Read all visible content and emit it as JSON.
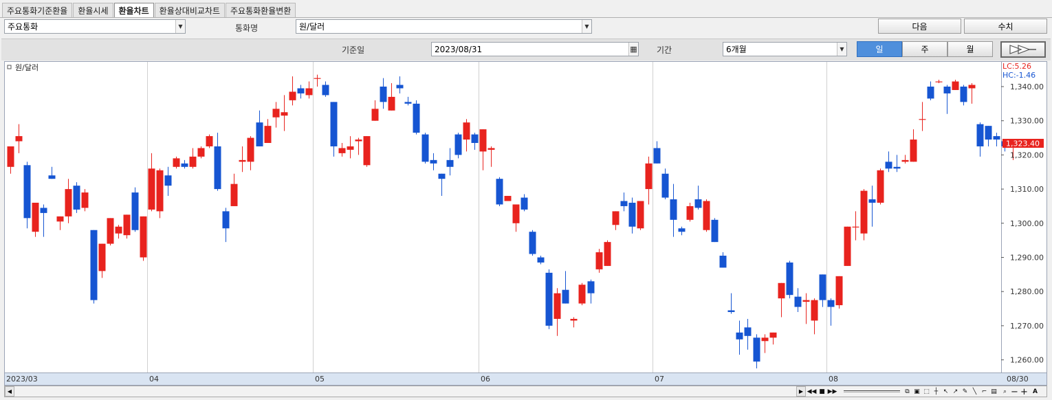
{
  "tabs": [
    {
      "label": "주요통화기준환율",
      "active": false
    },
    {
      "label": "환율시세",
      "active": false
    },
    {
      "label": "환율차트",
      "active": true
    },
    {
      "label": "환율상대비교차트",
      "active": false
    },
    {
      "label": "주요통화환율변환",
      "active": false
    }
  ],
  "row1": {
    "currency_group": "주요통화",
    "currency_name_label": "통화명",
    "currency_name": "원/달러",
    "next_button": "다음",
    "value_button": "수치"
  },
  "row2": {
    "base_date_label": "기준일",
    "base_date": "2023/08/31",
    "period_label": "기간",
    "period": "6개월",
    "period_units": [
      {
        "label": "일",
        "active": true
      },
      {
        "label": "주",
        "active": false
      },
      {
        "label": "월",
        "active": false
      }
    ],
    "forward_icon": "double-chevron-right-icon"
  },
  "colors": {
    "up": "#e8231e",
    "down": "#1655d2",
    "current_price_bg": "#e8231e"
  },
  "chart_data": {
    "type": "candlestick",
    "title": "원/달러",
    "lc_label": "LC:5.26",
    "hc_label": "HC:-1.46",
    "current_price_label": "1,323.40",
    "current_price": 1323.4,
    "ylim": [
      1255,
      1345
    ],
    "y_ticks": [
      {
        "value": 1260,
        "label": "1,260.00"
      },
      {
        "value": 1270,
        "label": "1,270.00"
      },
      {
        "value": 1280,
        "label": "1,280.00"
      },
      {
        "value": 1290,
        "label": "1,290.00"
      },
      {
        "value": 1300,
        "label": "1,300.00"
      },
      {
        "value": 1310,
        "label": "1,310.00"
      },
      {
        "value": 1320,
        "label": "1,320.00"
      },
      {
        "value": 1330,
        "label": "1,330.00"
      },
      {
        "value": 1340,
        "label": "1,340.00"
      }
    ],
    "x_labels": [
      {
        "index": 0,
        "label": "2023/03",
        "gridline": false
      },
      {
        "index": 17,
        "label": "04",
        "gridline": true
      },
      {
        "index": 37,
        "label": "05",
        "gridline": true
      },
      {
        "index": 57,
        "label": "06",
        "gridline": true
      },
      {
        "index": 78,
        "label": "07",
        "gridline": true
      },
      {
        "index": 99,
        "label": "08",
        "gridline": true
      },
      {
        "index": 120,
        "label": "08/30",
        "gridline": false
      }
    ],
    "candles": [
      [
        1316.5,
        1322.5,
        1314.5,
        1322.5
      ],
      [
        1324.0,
        1329.0,
        1320.5,
        1325.5
      ],
      [
        1317.0,
        1318.0,
        1298.5,
        1301.5
      ],
      [
        1297.5,
        1305.0,
        1296.0,
        1306.0
      ],
      [
        1304.5,
        1305.5,
        1296.0,
        1303.0
      ],
      [
        1314.0,
        1316.5,
        1313.0,
        1313.0
      ],
      [
        1300.5,
        1302.0,
        1298.0,
        1302.0
      ],
      [
        1302.0,
        1313.0,
        1300.0,
        1310.0
      ],
      [
        1311.0,
        1312.0,
        1303.0,
        1304.0
      ],
      [
        1304.5,
        1310.0,
        1303.5,
        1309.0
      ],
      [
        1298.0,
        1298.0,
        1276.5,
        1277.5
      ],
      [
        1286.0,
        1294.0,
        1284.0,
        1294.0
      ],
      [
        1294.0,
        1301.5,
        1293.5,
        1301.5
      ],
      [
        1297.0,
        1299.5,
        1295.5,
        1299.0
      ],
      [
        1296.5,
        1302.5,
        1295.5,
        1302.5
      ],
      [
        1309.0,
        1310.5,
        1297.5,
        1298.0
      ],
      [
        1290.0,
        1302.0,
        1289.0,
        1302.0
      ],
      [
        1304.0,
        1320.5,
        1303.5,
        1316.0
      ],
      [
        1303.5,
        1316.0,
        1301.5,
        1315.5
      ],
      [
        1314.0,
        1316.5,
        1308.0,
        1311.0
      ],
      [
        1316.5,
        1319.5,
        1316.0,
        1319.0
      ],
      [
        1317.5,
        1318.5,
        1316.0,
        1316.5
      ],
      [
        1316.5,
        1322.0,
        1316.0,
        1319.5
      ],
      [
        1319.5,
        1322.5,
        1319.0,
        1322.0
      ],
      [
        1322.5,
        1326.0,
        1322.0,
        1325.5
      ],
      [
        1322.5,
        1326.5,
        1309.5,
        1310.0
      ],
      [
        1303.5,
        1304.5,
        1294.5,
        1298.5
      ],
      [
        1305.0,
        1314.5,
        1305.0,
        1311.5
      ],
      [
        1318.0,
        1322.5,
        1315.0,
        1318.5
      ],
      [
        1318.0,
        1325.5,
        1315.5,
        1325.0
      ],
      [
        1329.5,
        1333.0,
        1322.5,
        1322.5
      ],
      [
        1323.5,
        1330.5,
        1323.5,
        1328.5
      ],
      [
        1331.0,
        1335.5,
        1328.0,
        1333.5
      ],
      [
        1331.5,
        1337.5,
        1327.0,
        1332.5
      ],
      [
        1336.0,
        1343.0,
        1334.5,
        1338.5
      ],
      [
        1339.5,
        1340.5,
        1336.5,
        1338.0
      ],
      [
        1337.5,
        1341.5,
        1336.5,
        1339.5
      ],
      [
        1342.5,
        1343.5,
        1340.0,
        1342.5
      ],
      [
        1340.5,
        1341.5,
        1337.0,
        1337.5
      ],
      [
        1335.5,
        1335.5,
        1319.5,
        1322.5
      ],
      [
        1320.5,
        1323.5,
        1319.5,
        1322.0
      ],
      [
        1321.5,
        1325.5,
        1319.0,
        1322.5
      ],
      [
        1324.0,
        1325.0,
        1320.0,
        1324.5
      ],
      [
        1317.0,
        1325.5,
        1316.5,
        1325.5
      ],
      [
        1330.0,
        1336.0,
        1330.0,
        1333.5
      ],
      [
        1340.0,
        1342.5,
        1333.5,
        1335.5
      ],
      [
        1333.0,
        1341.0,
        1333.0,
        1337.0
      ],
      [
        1340.5,
        1343.0,
        1338.0,
        1339.5
      ],
      [
        1335.5,
        1337.0,
        1334.5,
        1335.0
      ],
      [
        1335.0,
        1336.0,
        1326.0,
        1326.5
      ],
      [
        1326.0,
        1326.5,
        1317.5,
        1318.0
      ],
      [
        1318.5,
        1320.5,
        1315.5,
        1317.5
      ],
      [
        1314.5,
        1314.5,
        1308.0,
        1313.0
      ],
      [
        1318.5,
        1322.0,
        1314.0,
        1316.5
      ],
      [
        1326.0,
        1326.5,
        1319.0,
        1320.0
      ],
      [
        1324.5,
        1330.5,
        1321.0,
        1329.5
      ],
      [
        1326.0,
        1326.5,
        1321.5,
        1323.5
      ],
      [
        1321.0,
        1327.5,
        1315.5,
        1327.5
      ],
      [
        1321.5,
        1322.5,
        1316.5,
        1322.0
      ],
      [
        1313.0,
        1313.5,
        1305.0,
        1305.5
      ],
      [
        1306.5,
        1308.0,
        1306.5,
        1308.0
      ],
      [
        1300.0,
        1305.5,
        1297.5,
        1305.5
      ],
      [
        1307.5,
        1308.5,
        1303.5,
        1304.0
      ],
      [
        1297.5,
        1298.0,
        1290.5,
        1291.0
      ],
      [
        1290.0,
        1290.5,
        1288.0,
        1288.5
      ],
      [
        1285.5,
        1286.5,
        1269.0,
        1270.0
      ],
      [
        1272.0,
        1281.0,
        1267.0,
        1279.5
      ],
      [
        1280.5,
        1286.0,
        1276.5,
        1276.5
      ],
      [
        1271.5,
        1272.5,
        1269.5,
        1272.0
      ],
      [
        1276.5,
        1282.5,
        1276.0,
        1282.0
      ],
      [
        1283.0,
        1283.5,
        1276.5,
        1279.5
      ],
      [
        1286.5,
        1292.5,
        1285.5,
        1291.5
      ],
      [
        1287.5,
        1295.0,
        1287.5,
        1294.5
      ],
      [
        1299.5,
        1303.5,
        1298.0,
        1303.5
      ],
      [
        1306.5,
        1309.0,
        1303.5,
        1305.0
      ],
      [
        1306.0,
        1307.5,
        1297.0,
        1299.0
      ],
      [
        1298.5,
        1306.5,
        1298.0,
        1306.5
      ],
      [
        1310.0,
        1319.5,
        1305.5,
        1317.5
      ],
      [
        1322.0,
        1324.0,
        1317.5,
        1317.5
      ],
      [
        1314.5,
        1316.0,
        1307.0,
        1307.5
      ],
      [
        1307.0,
        1311.5,
        1296.0,
        1301.0
      ],
      [
        1298.5,
        1299.0,
        1296.5,
        1297.5
      ],
      [
        1301.0,
        1306.0,
        1300.5,
        1305.0
      ],
      [
        1307.0,
        1311.0,
        1304.0,
        1304.5
      ],
      [
        1298.0,
        1307.0,
        1297.5,
        1306.5
      ],
      [
        1301.0,
        1301.5,
        1294.5,
        1294.5
      ],
      [
        1290.5,
        1291.5,
        1287.0,
        1287.0
      ],
      [
        1274.5,
        1279.5,
        1273.5,
        1274.0
      ],
      [
        1268.0,
        1271.5,
        1261.5,
        1266.0
      ],
      [
        1269.5,
        1272.0,
        1263.0,
        1267.0
      ],
      [
        1266.5,
        1267.5,
        1257.5,
        1259.5
      ],
      [
        1265.5,
        1267.5,
        1262.0,
        1266.5
      ],
      [
        1266.5,
        1268.0,
        1264.5,
        1268.0
      ],
      [
        1278.0,
        1282.5,
        1272.5,
        1282.5
      ],
      [
        1288.5,
        1289.0,
        1278.0,
        1279.0
      ],
      [
        1278.5,
        1281.0,
        1274.0,
        1275.5
      ],
      [
        1277.0,
        1279.5,
        1270.5,
        1277.5
      ],
      [
        1271.5,
        1278.0,
        1267.5,
        1277.5
      ],
      [
        1285.0,
        1285.0,
        1275.5,
        1277.5
      ],
      [
        1277.5,
        1278.0,
        1270.0,
        1275.5
      ],
      [
        1276.0,
        1284.5,
        1275.0,
        1284.5
      ],
      [
        1287.5,
        1299.0,
        1287.5,
        1299.0
      ],
      [
        1299.0,
        1303.5,
        1295.0,
        1299.0
      ],
      [
        1297.0,
        1310.0,
        1295.0,
        1309.5
      ],
      [
        1307.0,
        1311.0,
        1299.0,
        1306.0
      ],
      [
        1306.0,
        1316.0,
        1305.5,
        1315.5
      ],
      [
        1318.0,
        1321.0,
        1315.0,
        1316.0
      ],
      [
        1316.5,
        1320.0,
        1315.0,
        1316.0
      ],
      [
        1318.0,
        1320.0,
        1317.5,
        1318.5
      ],
      [
        1318.0,
        1327.5,
        1318.0,
        1324.5
      ],
      [
        1330.5,
        1335.5,
        1327.0,
        1330.5
      ],
      [
        1340.0,
        1341.5,
        1336.0,
        1336.5
      ],
      [
        1341.5,
        1342.0,
        1341.0,
        1341.5
      ],
      [
        1340.0,
        1340.5,
        1332.0,
        1338.0
      ],
      [
        1339.0,
        1342.0,
        1339.0,
        1341.5
      ],
      [
        1340.0,
        1340.5,
        1334.5,
        1335.5
      ],
      [
        1339.5,
        1341.0,
        1335.0,
        1340.5
      ],
      [
        1329.0,
        1329.5,
        1319.5,
        1322.5
      ],
      [
        1328.5,
        1328.5,
        1322.5,
        1324.5
      ],
      [
        1325.5,
        1326.5,
        1322.5,
        1324.5
      ],
      [
        1324.0,
        1324.5,
        1321.0,
        1322.5
      ],
      [
        1323.0,
        1324.5,
        1318.5,
        1323.5
      ]
    ]
  },
  "scrollbar": {
    "left_arrow": "scroll-left-icon",
    "right_arrow": "scroll-right-icon",
    "controls": [
      "play-icon",
      "step-back-icon",
      "stop-icon",
      "step-forward-icon"
    ],
    "tools": [
      "copy-icon",
      "chart-icon",
      "zoom-area-icon",
      "crosshair-icon",
      "trend-icon",
      "cursor-icon",
      "draw-icon",
      "line-icon",
      "text-icon",
      "print-icon"
    ],
    "zoom_search": "magnifier-icon",
    "minus": "−",
    "plus": "+",
    "auto_label": "A"
  }
}
